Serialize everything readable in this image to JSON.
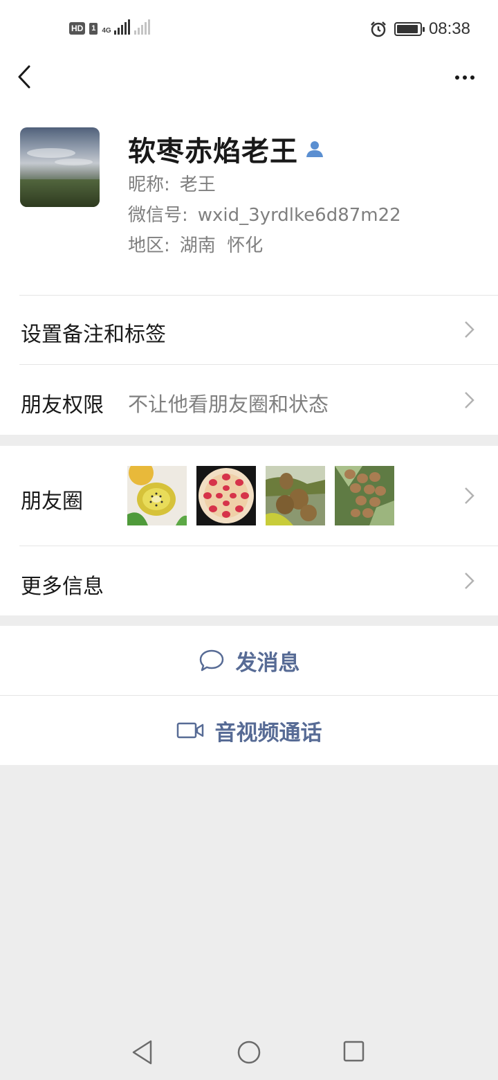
{
  "status_bar": {
    "left_badge": "HD",
    "sim_label": "1",
    "network": "4G",
    "time": "08:38"
  },
  "profile": {
    "display_name": "软枣赤焰老王",
    "nickname_label": "昵称:",
    "nickname": "老王",
    "wechat_id_label": "微信号:",
    "wechat_id": "wxid_3yrdlke6d87m22",
    "region_label": "地区:",
    "region": "湖南  怀化"
  },
  "settings": {
    "remark_label": "设置备注和标签",
    "permission_label": "朋友权限",
    "permission_value": "不让他看朋友圈和状态"
  },
  "moments": {
    "label": "朋友圈",
    "thumbnail_count": 4
  },
  "more_info": {
    "label": "更多信息"
  },
  "actions": {
    "message_label": "发消息",
    "call_label": "音视频通话"
  },
  "colors": {
    "link": "#576b95",
    "background": "#ededed",
    "verified_icon": "#5b8fd1"
  },
  "icons": [
    "back-chevron-icon",
    "more-dots-icon",
    "contact-person-icon",
    "chat-bubble-icon",
    "video-camera-icon",
    "chevron-right-icon",
    "alarm-icon",
    "battery-icon"
  ]
}
